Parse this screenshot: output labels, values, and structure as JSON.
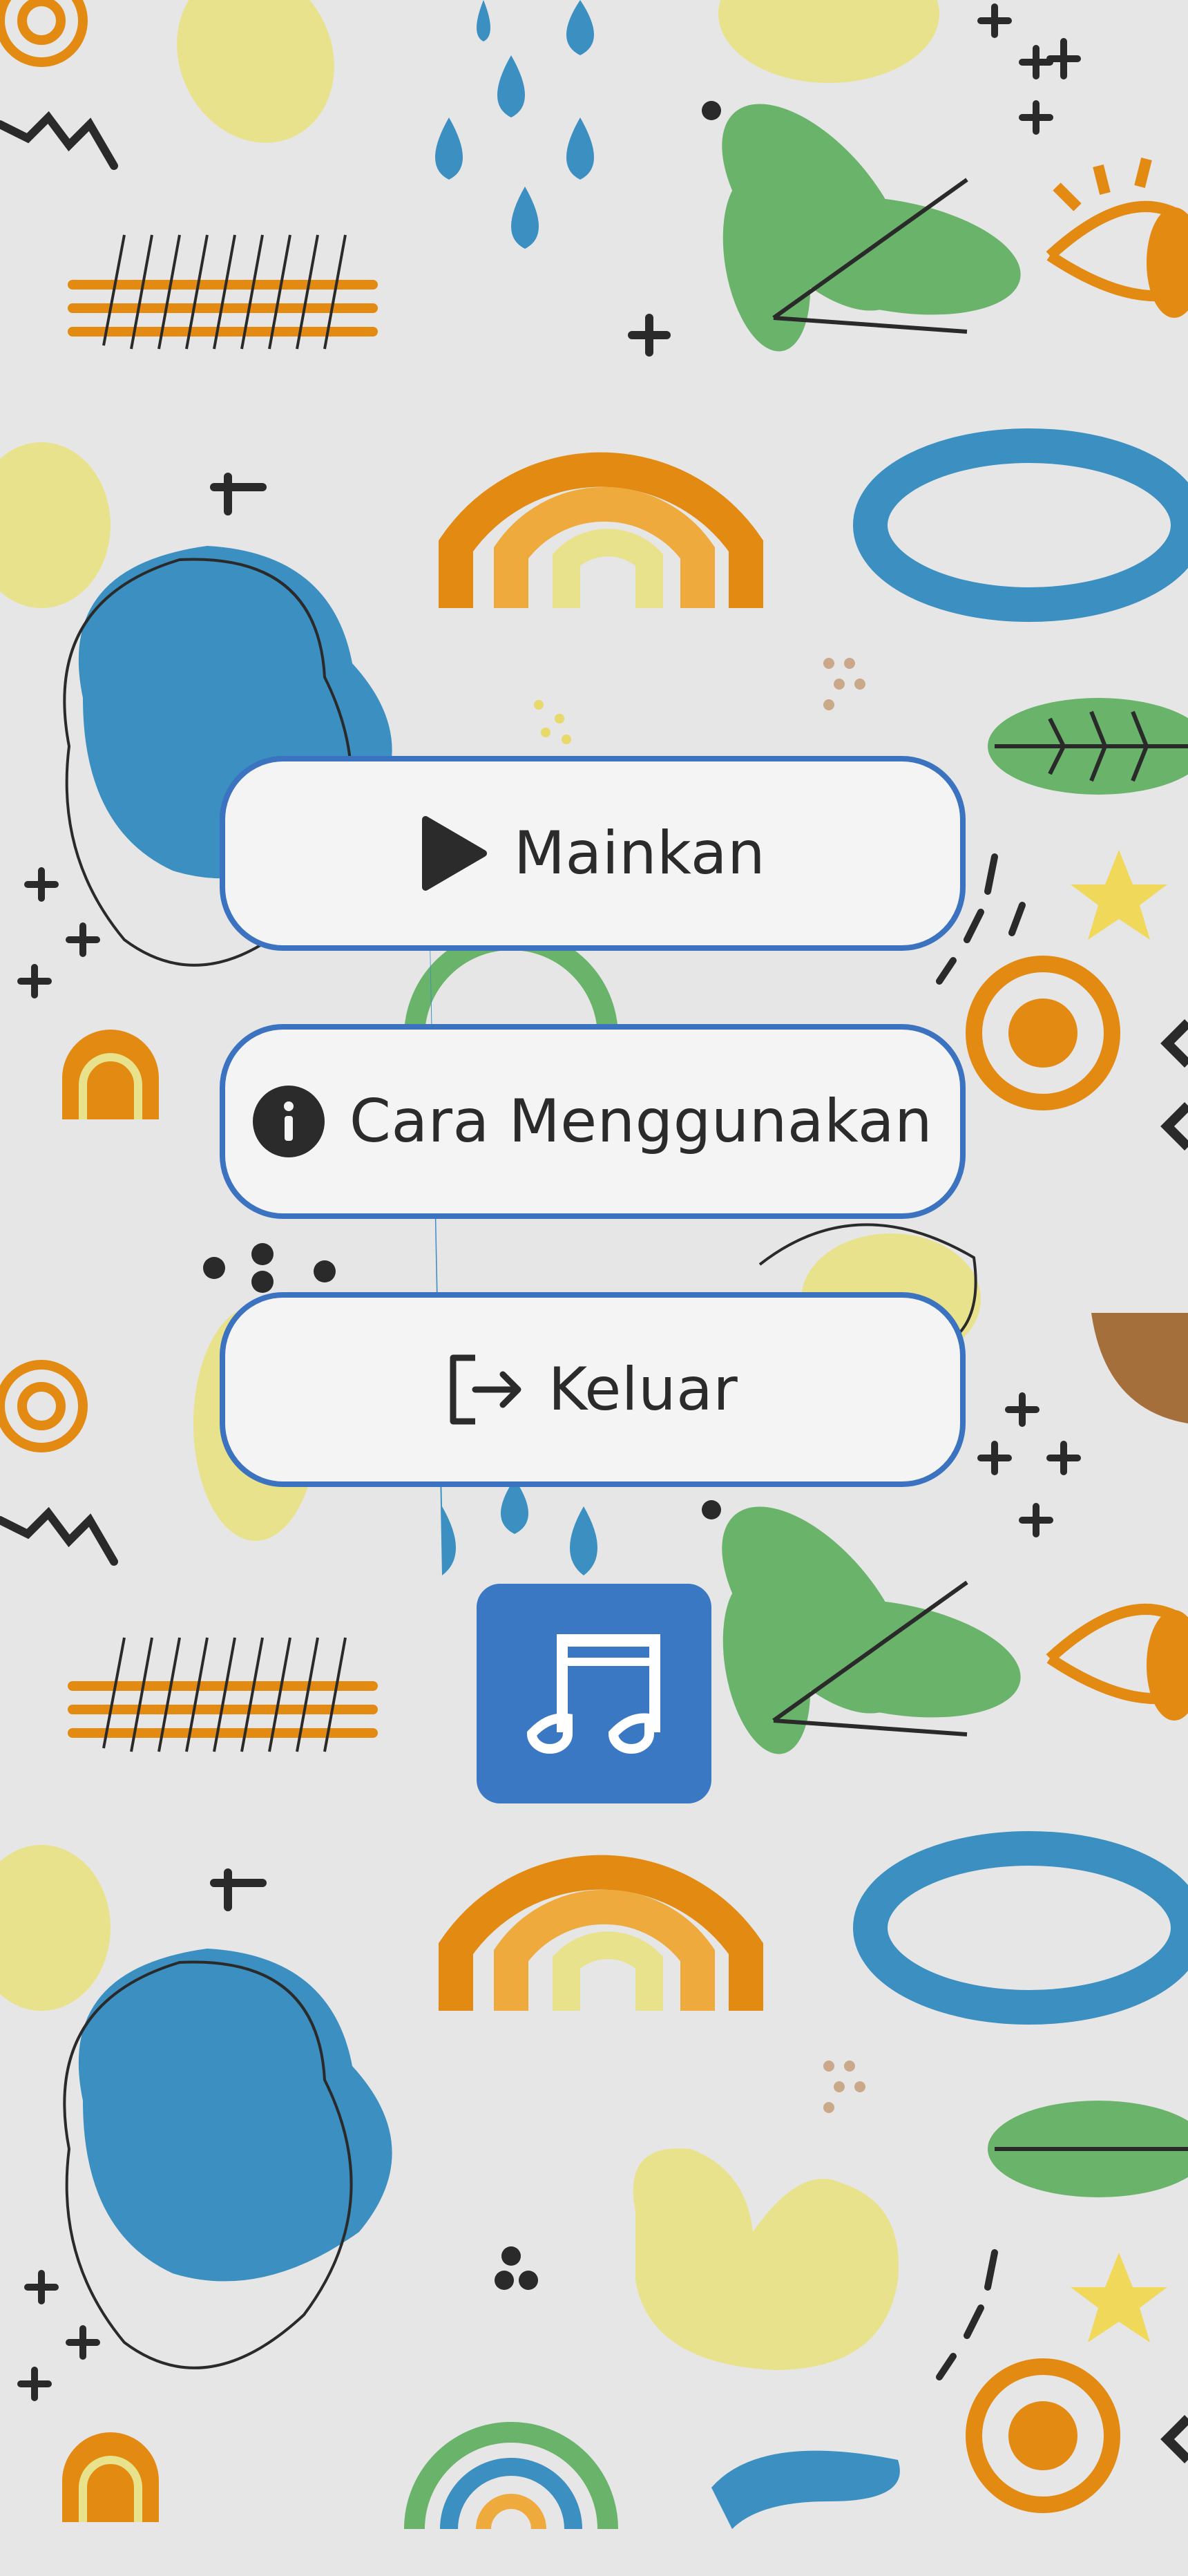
{
  "menu": {
    "play_label": "Mainkan",
    "help_label": "Cara Menggunakan",
    "exit_label": "Keluar"
  },
  "icons": {
    "play": "play-icon",
    "help": "info-icon",
    "exit": "logout-icon",
    "music": "music-note-icon"
  },
  "colors": {
    "button_border": "#3b73c0",
    "button_fill": "#f4f4f5",
    "music_button": "#3b78c3",
    "text": "#2b2b2b",
    "background": "#e6e6e6"
  }
}
